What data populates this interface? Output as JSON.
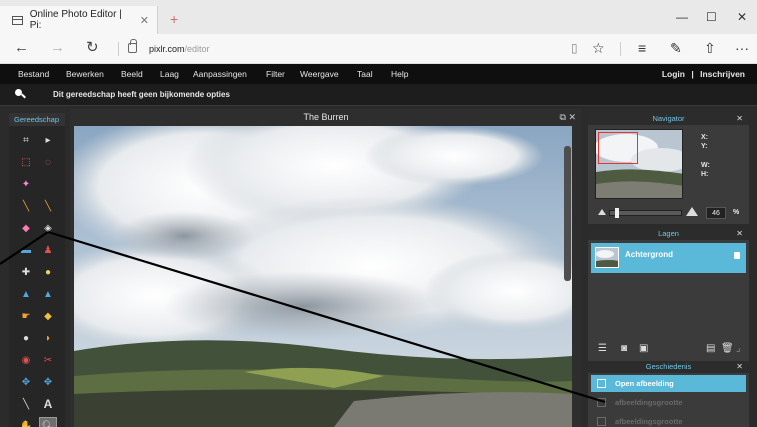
{
  "browser": {
    "tab_title": "Online Photo Editor | Pi:",
    "tab_close": "✕",
    "new_tab": "+",
    "url_host": "pixlr.com",
    "url_path": "/editor",
    "win_minimize": "—",
    "win_maximize": "☐",
    "win_close": "✕",
    "more": "···"
  },
  "menubar": {
    "items": [
      "Bestand",
      "Bewerken",
      "Beeld",
      "Laag",
      "Aanpassingen",
      "Filter",
      "Weergave",
      "Taal",
      "Help"
    ],
    "login": "Login",
    "divider": "|",
    "signup": "Inschrijven"
  },
  "options_bar": {
    "text": "Dit gereedschap heeft geen bijkomende opties"
  },
  "tools_panel": {
    "title": "Gereedschap"
  },
  "canvas": {
    "title": "The Burren",
    "controls": "⧉ ✕"
  },
  "navigator": {
    "title": "Navigator",
    "x_label": "X:",
    "y_label": "Y:",
    "w_label": "W:",
    "h_label": "H:",
    "zoom_value": "46",
    "zoom_unit": "%",
    "zoom_level": 0.08
  },
  "layers": {
    "title": "Lagen",
    "items": [
      {
        "name": "Achtergrond"
      }
    ]
  },
  "history": {
    "title": "Geschiedenis",
    "items": [
      {
        "label": "Open afbeelding",
        "state": "active"
      },
      {
        "label": "afbeeldingsgrootte",
        "state": "dim"
      },
      {
        "label": "afbeeldingsgrootte",
        "state": "dim"
      }
    ]
  },
  "colors": {
    "accent": "#5ab8d8",
    "panel_title": "#6fc6e6",
    "menubar": "#0f0f0f",
    "workspace": "#2b2b2b",
    "newtab": "#d4696d"
  },
  "icons": [
    "tab-page-icon",
    "back-icon",
    "forward-icon",
    "refresh-icon",
    "lock-icon",
    "reading-view-icon",
    "favorite-star-icon",
    "hub-icon",
    "note-icon",
    "share-icon",
    "search-tool-icon"
  ]
}
